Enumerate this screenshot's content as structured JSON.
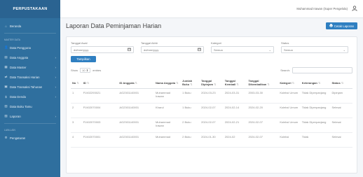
{
  "sidebar": {
    "brand": "PERPUSTAKAAN",
    "items_top": [
      {
        "label": "Beranda",
        "icon": "home-icon",
        "glyph": "⌂"
      }
    ],
    "section_main": "MASTER DATA",
    "items_main": [
      {
        "label": "Data Pengguna",
        "icon": "users-icon",
        "glyph": "👤",
        "chev": ""
      },
      {
        "label": "Data Anggota",
        "icon": "id-card-icon",
        "glyph": "▤",
        "chev": "›"
      },
      {
        "label": "Data Master",
        "icon": "database-icon",
        "glyph": "▦",
        "chev": "›"
      },
      {
        "label": "Data Transaksi Harian",
        "icon": "transaction-icon",
        "glyph": "⇄",
        "chev": "›"
      },
      {
        "label": "Data Transaksi Tahunan",
        "icon": "calendar-icon",
        "glyph": "▣",
        "chev": "›"
      },
      {
        "label": "Data Denda",
        "icon": "money-icon",
        "glyph": "$",
        "chev": "›"
      },
      {
        "label": "Data Buku Tamu",
        "icon": "guestbook-icon",
        "glyph": "▥",
        "chev": ""
      },
      {
        "label": "Laporan",
        "icon": "report-icon",
        "glyph": "▧",
        "chev": "›"
      }
    ],
    "section_other": "LAIN-LAIN",
    "items_other": [
      {
        "label": "Pengaturan",
        "icon": "gear-icon",
        "glyph": "⚙"
      }
    ]
  },
  "topbar": {
    "user_name": "Muhammad Irawan (Super Pengelola)",
    "user_icon": "user-icon"
  },
  "page": {
    "title": "Laporan Data Peminjaman Harian",
    "print_label": "Cetak Laporan",
    "print_icon": "printer-icon"
  },
  "filters": {
    "start_label": "Tanggal Awal",
    "start_placeholder": "dd/mm/yyyy",
    "end_label": "Tanggal Akhir",
    "end_placeholder": "dd/mm/yyyy",
    "category_label": "Kategori",
    "category_value": "Semua",
    "status_label": "Status",
    "status_value": "Semua",
    "apply_label": "Tampilkan"
  },
  "table_controls": {
    "show_label": "Show",
    "page_length": "10",
    "entries_label": "entries",
    "search_label": "Search:"
  },
  "table": {
    "headers": [
      "No",
      "ID",
      "ID Anggota",
      "Nama Anggota",
      "Jumlah Buku",
      "Tanggal Dipinjam",
      "Tanggal Kembali",
      "Tanggal Dikembalikan",
      "Kategori",
      "Keterangan",
      "Status"
    ],
    "rows": [
      [
        "1",
        "PJ402293021",
        "AG2301140001",
        "Muhammad Irawan",
        "1 Buku",
        "2024-03-23",
        "2024-03-31",
        "2003-03-30",
        "Koleksi Umum",
        "Tidak Diperpanjang",
        "Dipinjam"
      ],
      [
        "2",
        "PJ402070004",
        "AG2301140001",
        "Kharul",
        "1 Buku",
        "2024-02-07",
        "2024-02-14",
        "2024-02-20",
        "Koleksi Umum",
        "Tidak Diperpanjang",
        "Selesai"
      ],
      [
        "3",
        "PJ402070003",
        "AG2301140001",
        "Muhammad Irawan",
        "2 Buku",
        "2024-02-07",
        "2024-02-21",
        "2024-02-07",
        "Koleksi Umum",
        "Tidak Diperpanjang",
        "Selesai"
      ],
      [
        "4",
        "PJ402070001",
        "AG2301140001",
        "Muhammad",
        "2 Buku",
        "2024-01-30",
        "2024-02",
        "2024-02-07",
        "Koleksi",
        "Tidak",
        "Selesai"
      ]
    ]
  }
}
